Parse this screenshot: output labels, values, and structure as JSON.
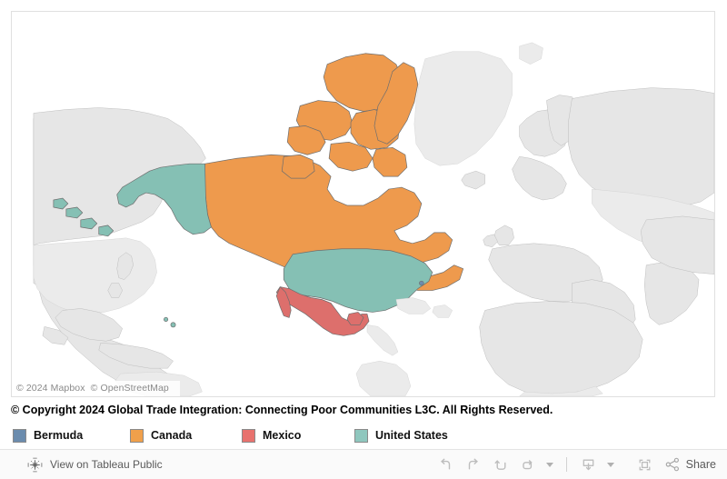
{
  "map": {
    "attribution": [
      "© 2024 Mapbox",
      "© OpenStreetMap"
    ],
    "regions": [
      {
        "name": "Canada",
        "color": "#ee9a4d"
      },
      {
        "name": "United States",
        "color": "#85c0b4"
      },
      {
        "name": "Mexico",
        "color": "#dd6f6c"
      },
      {
        "name": "Bermuda",
        "color": "#6b8cae"
      }
    ],
    "base_land_color": "#e6e6e6",
    "background_color": "#ffffff",
    "border_color": "#6e6e6e"
  },
  "copyright": {
    "text": "© Copyright 2024 Global Trade Integration: Connecting Poor Communities L3C. All Rights Reserved."
  },
  "legend": {
    "items": [
      {
        "label": "Bermuda",
        "color": "#6b8cae"
      },
      {
        "label": "Canada",
        "color": "#f0a04b"
      },
      {
        "label": "Mexico",
        "color": "#e8726e"
      },
      {
        "label": "United States",
        "color": "#8fc7be"
      }
    ]
  },
  "toolbar": {
    "tableau_link_label": "View on Tableau Public",
    "tableau_icon": "tableau-logo-icon",
    "buttons": [
      {
        "name": "undo-button",
        "icon": "undo-arrow-icon"
      },
      {
        "name": "redo-button",
        "icon": "redo-arrow-icon"
      },
      {
        "name": "revert-button",
        "icon": "revert-arrow-icon"
      },
      {
        "name": "refresh-button",
        "icon": "refresh-arrow-icon"
      },
      {
        "name": "refresh-dropdown",
        "icon": "caret-down-icon"
      },
      {
        "name": "download-button",
        "icon": "download-tray-icon"
      },
      {
        "name": "download-dropdown",
        "icon": "caret-down-icon"
      },
      {
        "name": "fullscreen-button",
        "icon": "fullscreen-frame-icon"
      }
    ],
    "share_label": "Share",
    "share_icon": "share-nodes-icon"
  }
}
